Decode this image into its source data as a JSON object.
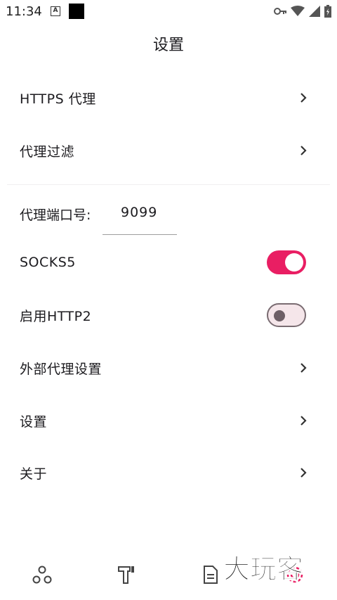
{
  "status_bar": {
    "time": "11:34",
    "a_badge": "A",
    "icons": [
      "key-icon",
      "wifi-icon",
      "signal-icon",
      "battery-icon"
    ]
  },
  "header": {
    "title": "设置"
  },
  "items": {
    "https_proxy": "HTTPS 代理",
    "proxy_filter": "代理过滤",
    "port_label": "代理端口号:",
    "port_value": "9099",
    "socks5": "SOCKS5",
    "http2": "启用HTTP2",
    "external_proxy": "外部代理设置",
    "settings": "设置",
    "about": "关于"
  },
  "toggles": {
    "socks5_enabled": true,
    "http2_enabled": false
  },
  "bottom_nav": {
    "icons": [
      "network-icon",
      "tools-icon",
      "document-icon",
      "settings-gear-icon"
    ]
  },
  "watermark": {
    "text": "大玩客"
  },
  "colors": {
    "accent": "#e91e63",
    "toggle_off_bg": "#f5e6ea",
    "toggle_off_border": "#7a6c72"
  }
}
